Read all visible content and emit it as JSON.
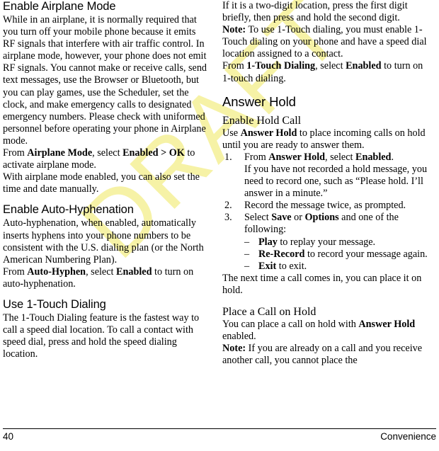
{
  "watermark": {
    "text": "DRAFT",
    "color": "#f6f2a6"
  },
  "footer": {
    "page_number": "40",
    "section_label": "Convenience"
  },
  "left_column": {
    "heading_airplane": "Enable Airplane Mode",
    "airplane_p1_a": "While in an airplane, it is normally required that you turn off your mobile phone because it emits RF signals that interfere with air traffic control. In airplane mode, however, your phone does not emit RF signals. You cannot make or receive calls, send text messages, use the Browser or Bluetooth, but you can play games, use the Scheduler, set the clock, and make emergency calls to designated emergency numbers. Please check with uniformed personnel before operating your phone in Airplane mode.",
    "airplane_p2_a": "From ",
    "airplane_p2_b": "Airplane Mode",
    "airplane_p2_c": ", select ",
    "airplane_p2_d": "Enabled > OK",
    "airplane_p2_e": " to activate airplane mode.",
    "airplane_p3": "With airplane mode enabled, you can also set the time and date manually.",
    "heading_hyphen": "Enable Auto-Hyphenation",
    "hyphen_p1": "Auto-hyphenation, when enabled, automatically inserts hyphens into your phone numbers to be consistent with the U.S. dialing plan (or the North American Numbering Plan).",
    "hyphen_p2_a": "From ",
    "hyphen_p2_b": "Auto-Hyphen",
    "hyphen_p2_c": ", select ",
    "hyphen_p2_d": "Enabled",
    "hyphen_p2_e": " to turn on auto-hyphenation.",
    "heading_onetouch": "Use 1-Touch Dialing",
    "onetouch_p1": "The 1-Touch Dialing feature is the fastest way to call a speed dial location. To call a contact with speed dial, press and hold the speed dialing location."
  },
  "right_column": {
    "onetouch_p2": "If it is a two-digit location, press the first digit briefly, then press and hold the second digit.",
    "note1_label": "Note:",
    "note1_text": " To use 1-Touch dialing, you must enable 1-Touch dialing on your phone and have a speed dial location assigned to a contact.",
    "onetouch_p3_a": "From ",
    "onetouch_p3_b": "1-Touch Dialing",
    "onetouch_p3_c": ", select ",
    "onetouch_p3_d": "Enabled",
    "onetouch_p3_e": " to turn on 1-touch dialing.",
    "heading_answer_hold": "Answer Hold",
    "subheading_enable_hold": "Enable Hold Call",
    "hold_p1_a": "Use ",
    "hold_p1_b": "Answer Hold",
    "hold_p1_c": " to place incoming calls on hold until you are ready to answer them.",
    "steps": [
      {
        "lead_a": "From ",
        "lead_b": "Answer Hold",
        "lead_c": ", select ",
        "lead_d": "Enabled",
        "lead_e": ".",
        "continuation": "If you have not recorded a hold message, you need to record one, such as “Please hold. I’ll answer in a minute.”"
      },
      {
        "lead_a": "Record the message twice, as prompted.",
        "lead_b": "",
        "lead_c": "",
        "lead_d": "",
        "lead_e": "",
        "continuation": ""
      },
      {
        "lead_a": "Select ",
        "lead_b": "Save",
        "lead_c": " or ",
        "lead_d": "Options",
        "lead_e": " and one of the following:",
        "continuation": ""
      }
    ],
    "sub_items": [
      {
        "bold": "Play",
        "rest": " to replay your message."
      },
      {
        "bold": "Re-Record",
        "rest": " to record your message again."
      },
      {
        "bold": "Exit",
        "rest": " to exit."
      }
    ],
    "after_steps": "The next time a call comes in, you can place it on hold.",
    "subheading_place_hold": "Place a Call on Hold",
    "place_p1_a": "You can place a call on hold with ",
    "place_p1_b": "Answer Hold",
    "place_p1_c": " enabled.",
    "note2_label": "Note:",
    "note2_text": " If you are already on a call and you receive another call, you cannot place the"
  }
}
